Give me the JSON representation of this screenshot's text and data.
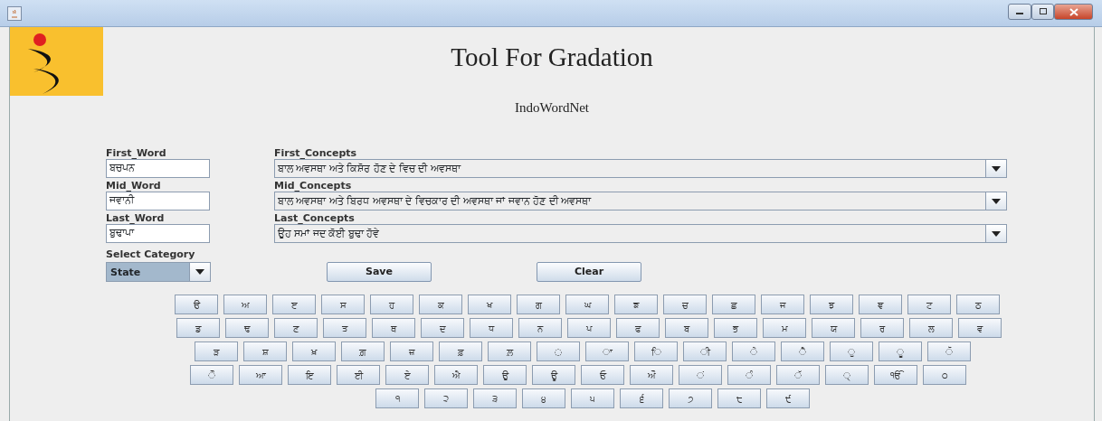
{
  "header": {
    "title": "Tool For Gradation",
    "subtitle": "IndoWordNet"
  },
  "words": [
    {
      "label": "First_Word",
      "value": "ਬਚਪਨ"
    },
    {
      "label": "Mid_Word",
      "value": "ਜਵਾਨੀ"
    },
    {
      "label": "Last_Word",
      "value": "ਬੁਢਾਪਾ"
    }
  ],
  "concepts": [
    {
      "label": "First_Concepts",
      "value": "ਬਾਲ ਅਵਸਥਾ ਅਤੇ ਕਿਸ਼ੋਰ ਹੋਣ ਦੇ ਵਿਚ ਦੀ ਅਵਸਥਾ"
    },
    {
      "label": "Mid_Concepts",
      "value": "ਬਾਲ ਅਵਸਥਾ ਅਤੇ ਬਿਰਧ ਅਵਸਥਾ ਦੇ ਵਿਚਕਾਰ ਦੀ ਅਵਸਥਾ ਜਾਂ ਜਵਾਨ ਹੋਣ ਦੀ ਅਵਸਥਾ"
    },
    {
      "label": "Last_Concepts",
      "value": "ਉਹ ਸਮਾਂ ਜਦ ਕੋਈ ਬੁਢਾ ਹੋਵੇ"
    }
  ],
  "category": {
    "label": "Select Category",
    "value": "State"
  },
  "buttons": [
    "Save",
    "Clear"
  ],
  "keyboard": [
    [
      "ੳ",
      "ਅ",
      "ੲ",
      "ਸ",
      "ਹ",
      "ਕ",
      "ਖ",
      "ਗ",
      "ਘ",
      "ਙ",
      "ਚ",
      "ਛ",
      "ਜ",
      "ਝ",
      "ਞ",
      "ਟ",
      "ਠ"
    ],
    [
      "ਡ",
      "ਢ",
      "ਣ",
      "ਤ",
      "ਥ",
      "ਦ",
      "ਧ",
      "ਨ",
      "ਪ",
      "ਫ",
      "ਬ",
      "ਭ",
      "ਮ",
      "ਯ",
      "ਰ",
      "ਲ",
      "ਵ"
    ],
    [
      "ੜ",
      "ਸ਼",
      "ਖ਼",
      "ਗ਼",
      "ਜ਼",
      "ਫ਼",
      "ਲ਼",
      "◌",
      "ਾ",
      "ਿ",
      "ੀ",
      "ੇ",
      "ੈ",
      "ੁ",
      "ੂ",
      "ੋ"
    ],
    [
      "ੌ",
      "ਆ",
      "ਇ",
      "ਈ",
      "ਏ",
      "ਐ",
      "ਉ",
      "ਊ",
      "ਓ",
      "ਔ",
      "ਂ",
      "ੰ",
      "ੱ",
      "੍",
      "ੴ",
      "੦"
    ],
    [
      "੧",
      "੨",
      "੩",
      "੪",
      "੫",
      "੬",
      "੭",
      "੮",
      "੯"
    ]
  ]
}
